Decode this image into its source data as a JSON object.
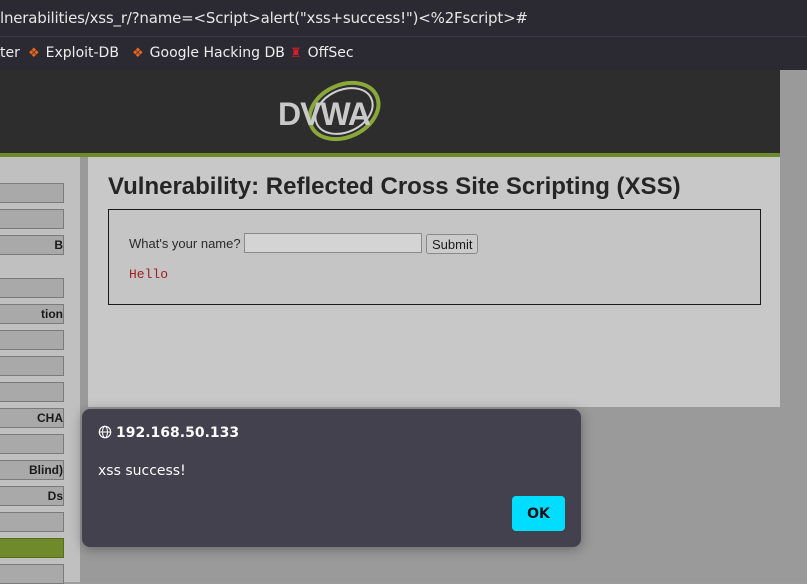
{
  "browser": {
    "url": "lnerabilities/xss_r/?name=<Script>alert(\"xss+success!\")<%2Fscript>#",
    "bookmarks": [
      {
        "label": "ter",
        "icon": "none"
      },
      {
        "label": "Exploit-DB",
        "icon": "exploit-db-icon"
      },
      {
        "label": "Google Hacking DB",
        "icon": "ghdb-icon"
      },
      {
        "label": "OffSec",
        "icon": "offsec-icon"
      }
    ]
  },
  "header": {
    "logo_text": "DVWA"
  },
  "sidebar": {
    "items": [
      {
        "label": ""
      },
      {
        "label": ""
      },
      {
        "label": "B"
      },
      {
        "label": ""
      },
      {
        "label": "tion"
      },
      {
        "label": ""
      },
      {
        "label": ""
      },
      {
        "label": ""
      },
      {
        "label": "CHA"
      },
      {
        "label": ""
      },
      {
        "label": "Blind)"
      },
      {
        "label": "Ds"
      },
      {
        "label": ""
      },
      {
        "label": ""
      },
      {
        "label": ""
      }
    ],
    "active_index": 13
  },
  "main": {
    "title": "Vulnerability: Reflected Cross Site Scripting (XSS)",
    "form": {
      "label": "What's your name?",
      "input_value": "",
      "submit_label": "Submit"
    },
    "output": "Hello"
  },
  "dialog": {
    "origin": "192.168.50.133",
    "message": "xss success!",
    "ok_label": "OK"
  },
  "colors": {
    "accent_green": "#6e8a2a",
    "ok_button": "#00ddff",
    "dialog_bg": "#42414d"
  }
}
